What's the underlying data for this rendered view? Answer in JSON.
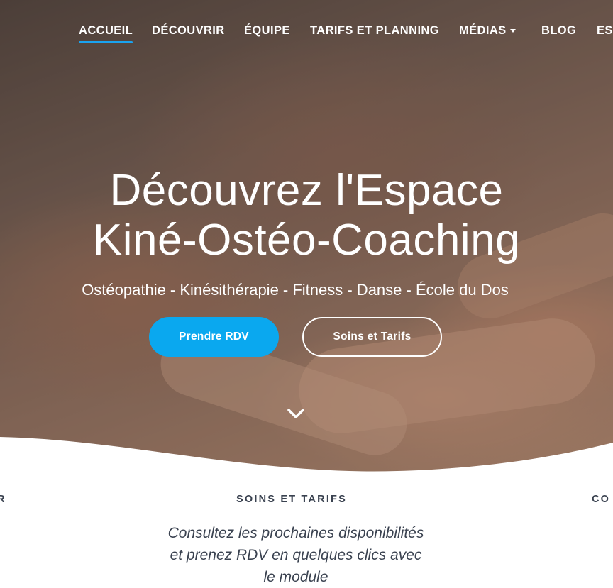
{
  "nav": {
    "items": [
      {
        "label": "ACCUEIL",
        "active": true
      },
      {
        "label": "DÉCOUVRIR"
      },
      {
        "label": "ÉQUIPE"
      },
      {
        "label": "TARIFS ET PLANNING"
      },
      {
        "label": "MÉDIAS",
        "dropdown": true
      },
      {
        "label": "BLOG"
      },
      {
        "label": "ESI"
      }
    ]
  },
  "hero": {
    "title_line1": "Découvrez l'Espace",
    "title_line2": "Kiné-Ostéo-Coaching",
    "subtitle": "Ostéopathie - Kinésithérapie - Fitness - Danse - École du Dos",
    "primary_button": "Prendre RDV",
    "secondary_button": "Soins et Tarifs",
    "scroll_icon": "chevron-down-icon"
  },
  "features": {
    "left_heading": "R",
    "center_heading": "SOINS ET TARIFS",
    "center_text": "Consultez les prochaines disponibilités et prenez RDV en quelques clics avec le module",
    "right_heading": "CO"
  },
  "colors": {
    "accent": "#0aa8ef",
    "text_dark": "#3a4250"
  }
}
